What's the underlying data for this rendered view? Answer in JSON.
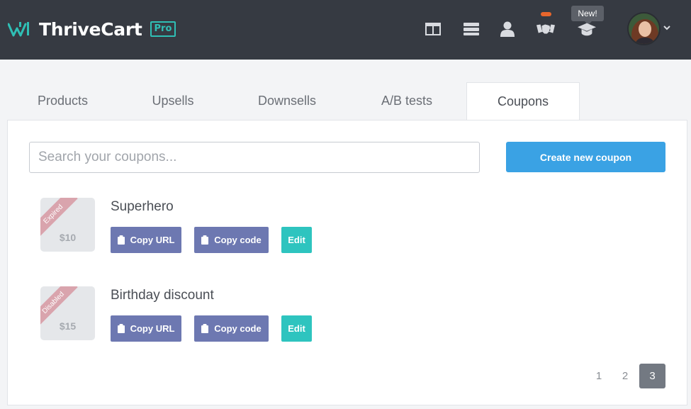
{
  "app": {
    "name": "ThriveCart",
    "edition_badge": "Pro"
  },
  "header": {
    "icons": [
      "layout-icon",
      "list-icon",
      "user-icon",
      "handshake-icon",
      "graduation-cap-icon"
    ],
    "new_tooltip": "New!",
    "notification_color": "#e8662c"
  },
  "tabs": [
    {
      "label": "Products",
      "active": false
    },
    {
      "label": "Upsells",
      "active": false
    },
    {
      "label": "Downsells",
      "active": false
    },
    {
      "label": "A/B tests",
      "active": false
    },
    {
      "label": "Coupons",
      "active": true
    }
  ],
  "search": {
    "placeholder": "Search your coupons..."
  },
  "create_button": "Create new coupon",
  "coupons": [
    {
      "name": "Superhero",
      "status": "Expired",
      "amount": "$10",
      "buttons": {
        "copy_url": "Copy URL",
        "copy_code": "Copy code",
        "edit": "Edit"
      }
    },
    {
      "name": "Birthday discount",
      "status": "Disabled",
      "amount": "$15",
      "buttons": {
        "copy_url": "Copy URL",
        "copy_code": "Copy code",
        "edit": "Edit"
      }
    }
  ],
  "pagination": {
    "pages": [
      "1",
      "2",
      "3"
    ],
    "current": "3"
  },
  "colors": {
    "topbar": "#363a42",
    "brand_teal": "#2fbfb5",
    "primary_blue": "#3aa2e4",
    "copy_button": "#6d78b1",
    "edit_button": "#2ec4bf",
    "ribbon": "#d9a4ad"
  }
}
